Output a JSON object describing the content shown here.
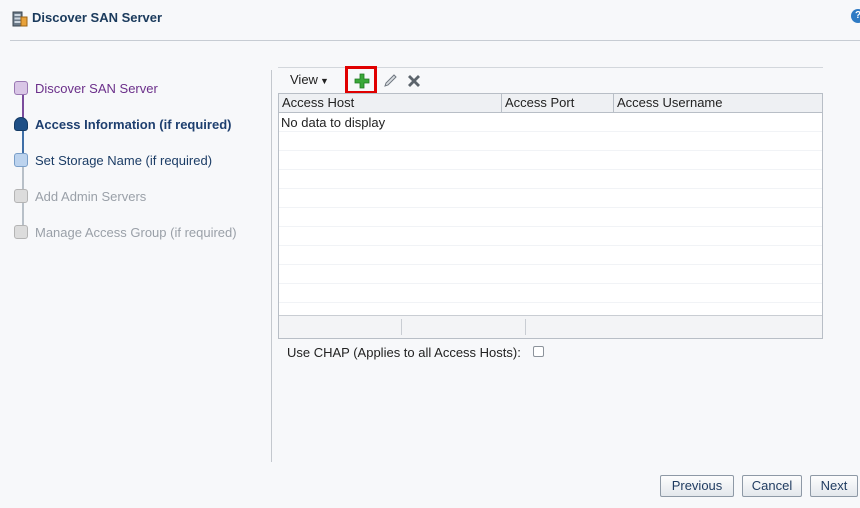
{
  "window": {
    "title": "Discover SAN Server",
    "help_glyph": "?"
  },
  "train": {
    "steps": [
      {
        "label": "Discover SAN Server",
        "state": "visited"
      },
      {
        "label": "Access Information (if required)",
        "state": "current"
      },
      {
        "label": "Set Storage Name (if required)",
        "state": "next"
      },
      {
        "label": "Add Admin Servers",
        "state": "disabled"
      },
      {
        "label": "Manage Access Group (if required)",
        "state": "disabled"
      }
    ]
  },
  "toolbar": {
    "view_label": "View",
    "add_icon": "add-icon",
    "edit_icon": "edit-icon",
    "delete_icon": "delete-icon"
  },
  "table": {
    "columns": [
      "Access Host",
      "Access Port",
      "Access Username"
    ],
    "rows": [],
    "empty_message": "No data to display"
  },
  "chap": {
    "label": "Use CHAP (Applies to all Access Hosts):",
    "checked": false
  },
  "buttons": {
    "previous": "Previous",
    "cancel": "Cancel",
    "next": "Next"
  },
  "colors": {
    "accent": "#1e4f86",
    "highlight_box": "#e00000",
    "add_green": "#3aa83a"
  }
}
